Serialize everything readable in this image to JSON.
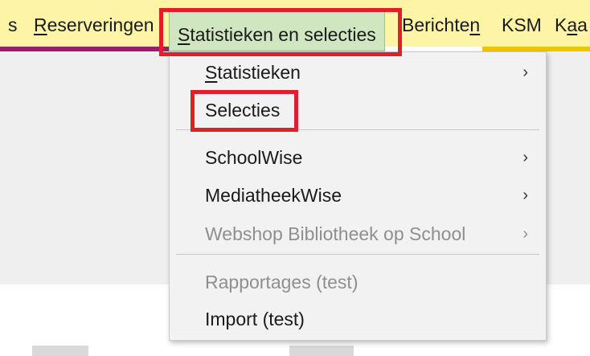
{
  "menubar": {
    "items": [
      {
        "label": "s",
        "underline_index": -1
      },
      {
        "label": "Reserveringen",
        "underline_index": 0
      },
      {
        "label": "Statistieken en selecties",
        "underline_index": 0
      },
      {
        "label": "Berichten",
        "underline_index": 8
      },
      {
        "label": "KSM",
        "underline_index": -1
      },
      {
        "label": "Kaa",
        "underline_index": 1
      }
    ],
    "open_item_index": 2
  },
  "dropdown": {
    "items": [
      {
        "label": "Statistieken",
        "has_submenu": true,
        "disabled": false,
        "underline_index": 0
      },
      {
        "label": "Selecties",
        "has_submenu": false,
        "disabled": false,
        "underline_index": -1
      },
      {
        "label": "SchoolWise",
        "has_submenu": true,
        "disabled": false,
        "underline_index": -1
      },
      {
        "label": "MediatheekWise",
        "has_submenu": true,
        "disabled": false,
        "underline_index": -1
      },
      {
        "label": "Webshop Bibliotheek op School",
        "has_submenu": true,
        "disabled": true,
        "underline_index": -1
      },
      {
        "label": "Rapportages (test)",
        "has_submenu": false,
        "disabled": true,
        "underline_index": -1
      },
      {
        "label": "Import (test)",
        "has_submenu": false,
        "disabled": false,
        "underline_index": -1
      }
    ],
    "submenu_glyph": "›"
  },
  "colors": {
    "menubar_bg": "#fdf4a6",
    "open_item_bg": "#cfe6c0",
    "highlight_border": "#e01f2a",
    "accent_purple": "#9a1f6a",
    "accent_yellow": "#f1c400",
    "disabled_text": "#8f8f8f"
  },
  "icons": {
    "submenu_indicator": "chevron-right-icon"
  }
}
